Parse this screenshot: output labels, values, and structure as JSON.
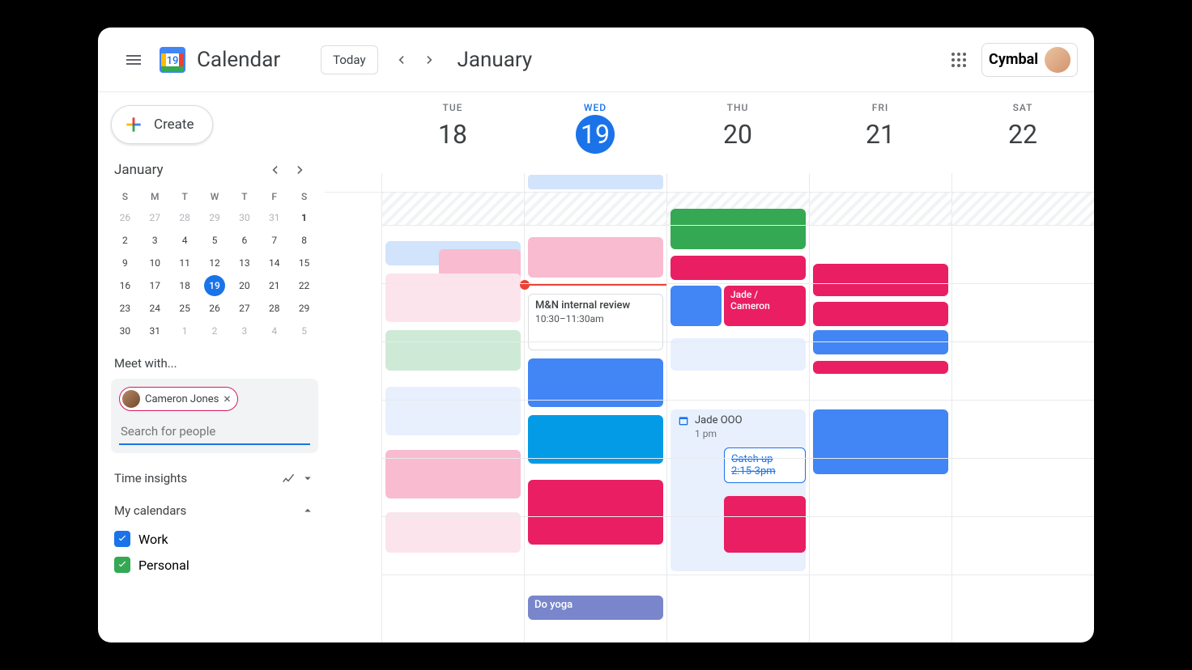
{
  "header": {
    "app_title": "Calendar",
    "today_label": "Today",
    "month_label": "January",
    "brand": "Cymbal"
  },
  "sidebar": {
    "create_label": "Create",
    "mini_month": "January",
    "dow": [
      "S",
      "M",
      "T",
      "W",
      "T",
      "F",
      "S"
    ],
    "mini_days": [
      {
        "n": "26",
        "o": true
      },
      {
        "n": "27",
        "o": true
      },
      {
        "n": "28",
        "o": true
      },
      {
        "n": "29",
        "o": true
      },
      {
        "n": "30",
        "o": true
      },
      {
        "n": "31",
        "o": true
      },
      {
        "n": "1",
        "b": true
      },
      {
        "n": "2"
      },
      {
        "n": "3"
      },
      {
        "n": "4"
      },
      {
        "n": "5"
      },
      {
        "n": "6"
      },
      {
        "n": "7"
      },
      {
        "n": "8"
      },
      {
        "n": "9"
      },
      {
        "n": "10"
      },
      {
        "n": "11"
      },
      {
        "n": "12"
      },
      {
        "n": "13"
      },
      {
        "n": "14"
      },
      {
        "n": "15"
      },
      {
        "n": "16"
      },
      {
        "n": "17"
      },
      {
        "n": "18"
      },
      {
        "n": "19",
        "today": true
      },
      {
        "n": "20"
      },
      {
        "n": "21"
      },
      {
        "n": "22"
      },
      {
        "n": "23"
      },
      {
        "n": "24"
      },
      {
        "n": "25"
      },
      {
        "n": "26"
      },
      {
        "n": "27"
      },
      {
        "n": "28"
      },
      {
        "n": "29"
      },
      {
        "n": "30"
      },
      {
        "n": "31"
      },
      {
        "n": "1",
        "o": true
      },
      {
        "n": "2",
        "o": true
      },
      {
        "n": "3",
        "o": true
      },
      {
        "n": "4",
        "o": true
      },
      {
        "n": "5",
        "o": true
      }
    ],
    "meet_with_label": "Meet with...",
    "chip_name": "Cameron Jones",
    "search_placeholder": "Search for people",
    "time_insights_label": "Time insights",
    "my_calendars_label": "My calendars",
    "cal_work": "Work",
    "cal_personal": "Personal"
  },
  "days": [
    {
      "dow": "TUE",
      "num": "18"
    },
    {
      "dow": "WED",
      "num": "19",
      "current": true
    },
    {
      "dow": "THU",
      "num": "20"
    },
    {
      "dow": "FRI",
      "num": "21"
    },
    {
      "dow": "SAT",
      "num": "22"
    }
  ],
  "events": {
    "mn_review_title": "M&N internal review",
    "mn_review_time": "10:30–11:30am",
    "jade_cameron": "Jade / Cameron",
    "jade_ooo_title": "Jade OOO",
    "jade_ooo_time": "1 pm",
    "catchup_title": "Catch up",
    "catchup_time": "2:15-3pm",
    "do_yoga": "Do yoga"
  },
  "colors": {
    "blue": "#4285f4",
    "blue_dark": "#1a73e8",
    "cyan": "#039be5",
    "pink": "#e91e63",
    "pink_light": "#f8bbd0",
    "pink_lighter": "#fce4ec",
    "green": "#34a853",
    "green_light": "#ceead6",
    "purple": "#7986cb",
    "blue_pale": "#d2e3fc",
    "blue_paler": "#e8f0fe"
  }
}
